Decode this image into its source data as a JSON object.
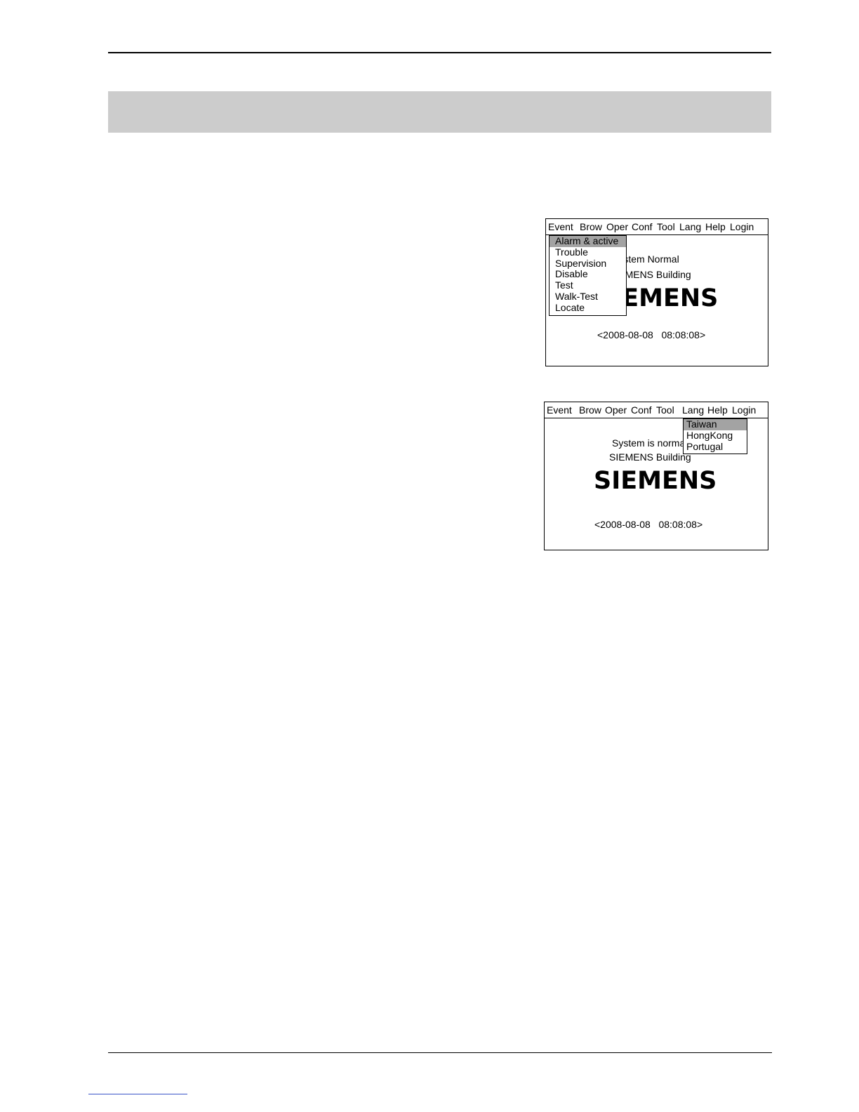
{
  "screen1": {
    "menu": [
      "Event",
      "Brow",
      "Oper",
      "Conf",
      "Tool",
      "Lang",
      "Help",
      "Login"
    ],
    "status": "System Normal",
    "building": "SIEMENS Building",
    "logo": "SIEMENS",
    "datetime": "<2008-08-08   08:08:08>",
    "dropdown": {
      "items": [
        "Alarm & active",
        "Trouble",
        "Supervision",
        "Disable",
        "Test",
        "Walk-Test",
        "Locate"
      ],
      "selected": "Alarm & active"
    }
  },
  "screen2": {
    "menu": [
      "Event",
      "Brow",
      "Oper",
      "Conf",
      "Tool",
      "Lang",
      "Help",
      "Login"
    ],
    "status": "System is normal",
    "building": "SIEMENS Building",
    "logo": "SIEMENS",
    "datetime": "<2008-08-08   08:08:08>",
    "dropdown": {
      "items": [
        "Taiwan",
        "HongKong",
        "Portugal"
      ],
      "selected": "Taiwan"
    }
  }
}
